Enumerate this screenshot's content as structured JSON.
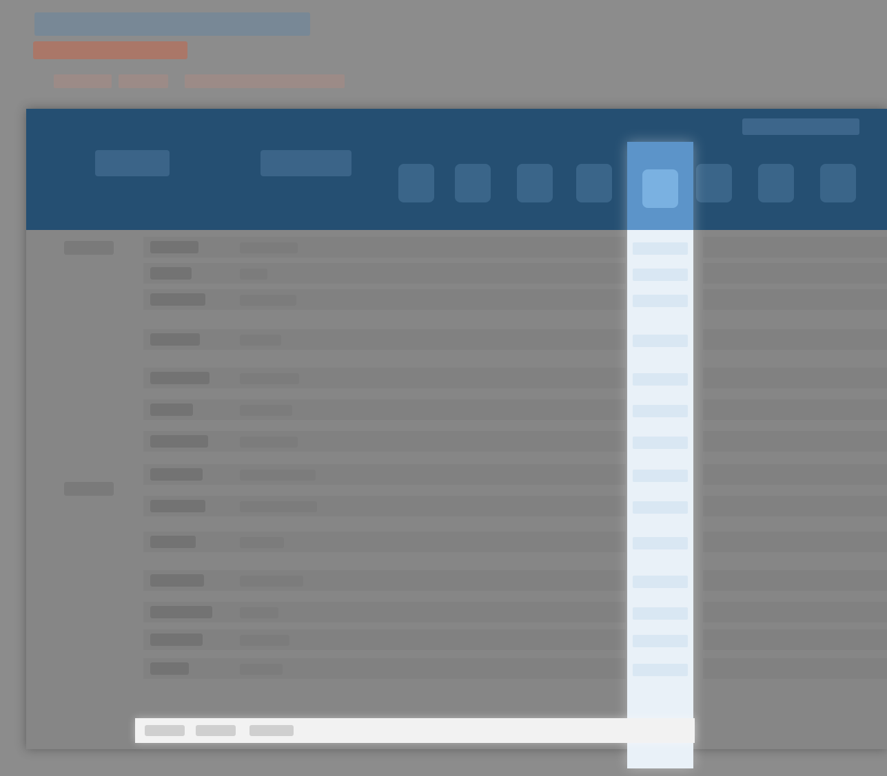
{
  "page": {
    "title": "",
    "alert": "",
    "breadcrumb": [
      "",
      "",
      ""
    ]
  },
  "table": {
    "header_group": "",
    "columns": [
      "",
      ""
    ],
    "days": [
      "",
      "",
      "",
      "",
      "",
      "",
      "",
      ""
    ],
    "selected_day_index": 4,
    "groups": [
      "",
      ""
    ],
    "rows": [
      {
        "label": "",
        "value": ""
      },
      {
        "label": "",
        "value": ""
      },
      {
        "label": "",
        "value": ""
      },
      {
        "label": "",
        "value": ""
      },
      {
        "label": "",
        "value": ""
      },
      {
        "label": "",
        "value": ""
      },
      {
        "label": "",
        "value": ""
      },
      {
        "label": "",
        "value": ""
      },
      {
        "label": "",
        "value": ""
      },
      {
        "label": "",
        "value": ""
      },
      {
        "label": "",
        "value": ""
      },
      {
        "label": "",
        "value": ""
      },
      {
        "label": "",
        "value": ""
      },
      {
        "label": "",
        "value": ""
      }
    ],
    "footer": [
      "",
      "",
      ""
    ]
  },
  "colors": {
    "header_bg": "#254f72",
    "selected_column": "#5c94c9",
    "selected_column_body": "#e9f1f8",
    "alert": "#b2725f",
    "page_bg": "#8c8c8c"
  }
}
